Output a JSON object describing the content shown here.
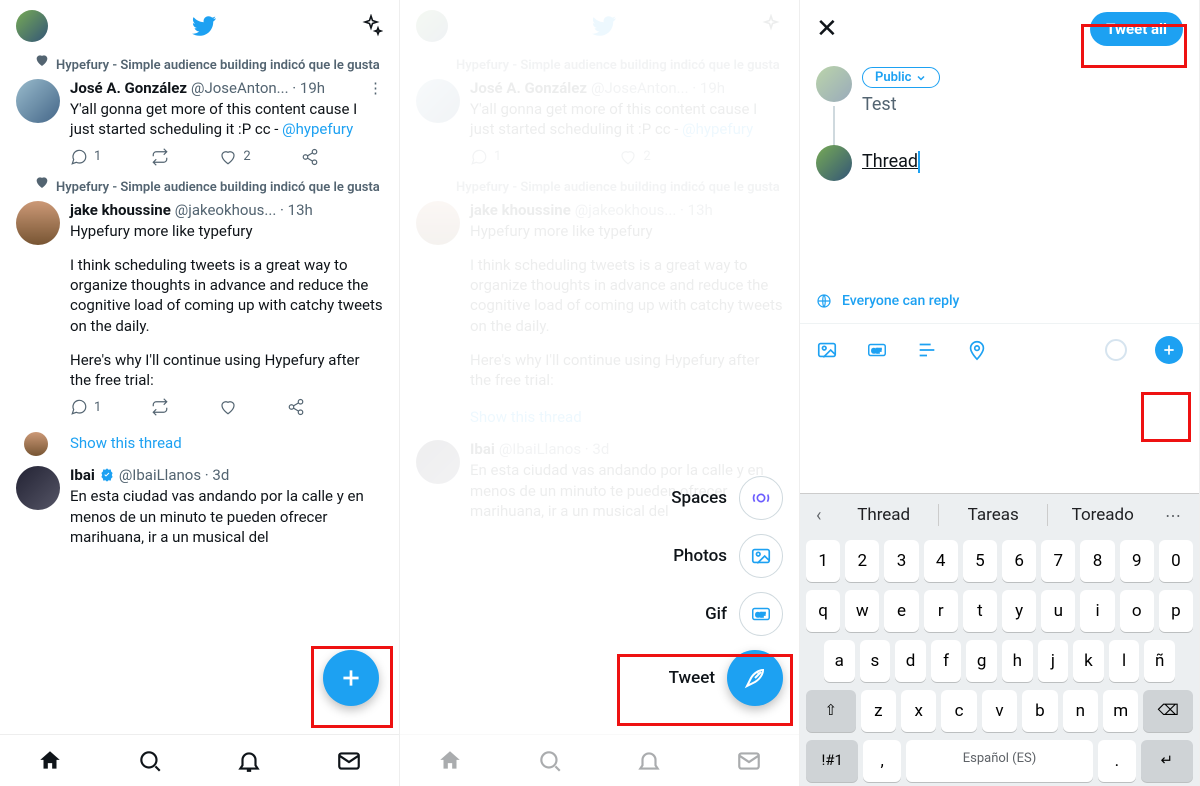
{
  "panel1": {
    "context1": "Hypefury - Simple audience building indicó que le gusta",
    "tweet1": {
      "name": "José A. González",
      "handle": "@JoseAnton... · 19h",
      "text_a": "Y'all gonna get more of this content cause I just started scheduling it :P  cc - ",
      "mention": "@hypefury",
      "replies": "1",
      "likes": "2"
    },
    "context2": "Hypefury - Simple audience building indicó que le gusta",
    "tweet2": {
      "name": "jake khoussine",
      "handle": "@jakeokhous... · 13h",
      "text": "Hypefury more like typefury",
      "text2": "I think scheduling tweets is a great way to organize thoughts in advance and reduce the cognitive load of coming up with catchy tweets on the daily.",
      "text3": "Here's why I'll continue using Hypefury after the free trial:",
      "replies": "1"
    },
    "showthread": "Show this thread",
    "tweet3": {
      "name": "Ibai",
      "handle": "@IbaiLlanos · 3d",
      "text": "En esta ciudad vas andando por la calle y en menos de un minuto te pueden ofrecer marihuana, ir a un musical del"
    }
  },
  "panel2": {
    "menu": {
      "spaces": "Spaces",
      "photos": "Photos",
      "gif": "Gif",
      "tweet": "Tweet"
    }
  },
  "panel3": {
    "tweetall": "Tweet all",
    "audience": "Public",
    "text1": "Test",
    "text2": "Thread",
    "reply": "Everyone can reply",
    "suggestions": {
      "w1": "Thread",
      "w2": "Tareas",
      "w3": "Toreado"
    },
    "keys_row1": [
      "1",
      "2",
      "3",
      "4",
      "5",
      "6",
      "7",
      "8",
      "9",
      "0"
    ],
    "keys_row2": [
      "q",
      "w",
      "e",
      "r",
      "t",
      "y",
      "u",
      "i",
      "o",
      "p"
    ],
    "keys_row3": [
      "a",
      "s",
      "d",
      "f",
      "g",
      "h",
      "j",
      "k",
      "l",
      "ñ"
    ],
    "keys_row4": [
      "z",
      "x",
      "c",
      "v",
      "b",
      "n",
      "m"
    ],
    "space_label": "Español (ES)",
    "symkey": "!#1",
    "comma": ",",
    "period": "."
  }
}
